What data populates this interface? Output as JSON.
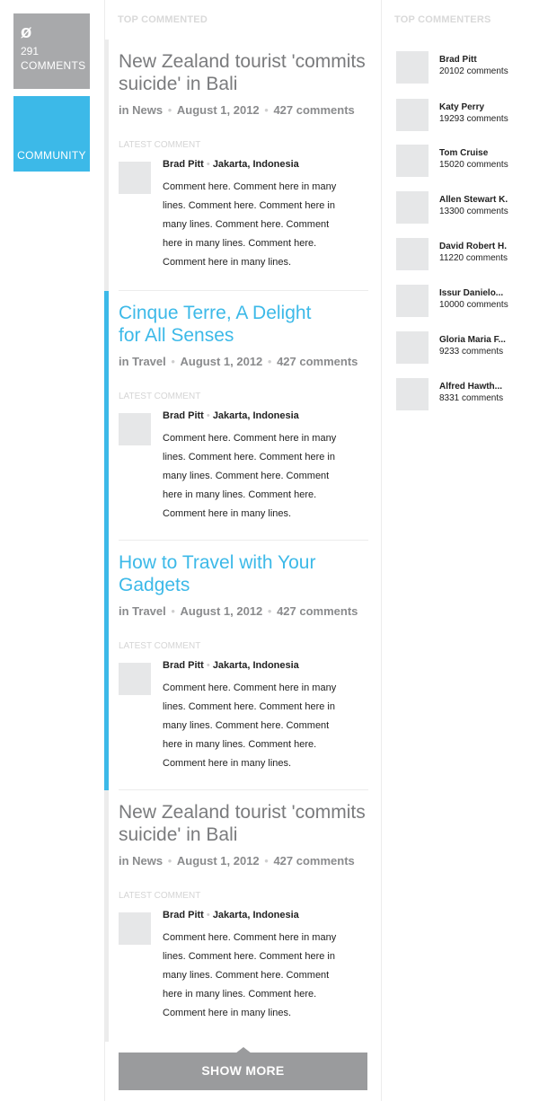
{
  "nav": {
    "comments_symbol": "ø",
    "comments_count": "291",
    "comments_label": "COMMENTS",
    "community_label": "COMMUNITY"
  },
  "headings": {
    "top_commented": "TOP COMMENTED",
    "top_commenters": "TOP COMMENTERS"
  },
  "articles": [
    {
      "title_line1": "New Zealand tourist 'commits",
      "title_line2": "suicide' in Bali",
      "category": "in News",
      "date": "August 1, 2012",
      "comments": "427 comments",
      "latest_label": "LATEST COMMENT",
      "comment_author": "Brad Pitt",
      "comment_location": "Jakarta, Indonesia",
      "comment_lines": [
        "Comment here. Comment here in many",
        "lines. Comment here. Comment here in",
        "many lines. Comment here. Comment",
        "here in many lines. Comment here.",
        "Comment here in many lines."
      ]
    },
    {
      "title_line1": "Cinque Terre, A Delight",
      "title_line2": "for All Senses",
      "category": "in Travel",
      "date": "August 1, 2012",
      "comments": "427 comments",
      "latest_label": "LATEST COMMENT",
      "comment_author": "Brad Pitt",
      "comment_location": "Jakarta, Indonesia",
      "comment_lines": [
        "Comment here. Comment here in many",
        "lines. Comment here. Comment here in",
        "many lines. Comment here. Comment",
        "here in many lines. Comment here.",
        "Comment here in many lines."
      ]
    },
    {
      "title_line1": "How to Travel with Your",
      "title_line2": "Gadgets",
      "category": "in Travel",
      "date": "August 1, 2012",
      "comments": "427 comments",
      "latest_label": "LATEST COMMENT",
      "comment_author": "Brad Pitt",
      "comment_location": "Jakarta, Indonesia",
      "comment_lines": [
        "Comment here. Comment here in many",
        "lines. Comment here. Comment here in",
        "many lines. Comment here. Comment",
        "here in many lines. Comment here.",
        "Comment here in many lines."
      ]
    },
    {
      "title_line1": "New Zealand tourist 'commits",
      "title_line2": "suicide' in Bali",
      "category": "in News",
      "date": "August 1, 2012",
      "comments": "427 comments",
      "latest_label": "LATEST COMMENT",
      "comment_author": "Brad Pitt",
      "comment_location": "Jakarta, Indonesia",
      "comment_lines": [
        "Comment here. Comment here in many",
        "lines. Comment here. Comment here in",
        "many lines. Comment here. Comment",
        "here in many lines. Comment here.",
        "Comment here in many lines."
      ]
    }
  ],
  "show_more_label": "SHOW MORE",
  "commenters": [
    {
      "name": "Brad Pitt",
      "count": "20102 comments"
    },
    {
      "name": "Katy Perry",
      "count": "19293 comments"
    },
    {
      "name": "Tom Cruise",
      "count": "15020 comments"
    },
    {
      "name": "Allen Stewart K.",
      "count": "13300 comments"
    },
    {
      "name": "David Robert H.",
      "count": "11220 comments"
    },
    {
      "name": "Issur Danielo...",
      "count": "10000 comments"
    },
    {
      "name": "Gloria Maria F...",
      "count": "9233 comments"
    },
    {
      "name": "Alfred Hawth...",
      "count": "8331 comments"
    }
  ],
  "colors": {
    "accent": "#3cb9e8",
    "nav_gray": "#a8a9ab",
    "button_gray": "#9a9b9d"
  }
}
